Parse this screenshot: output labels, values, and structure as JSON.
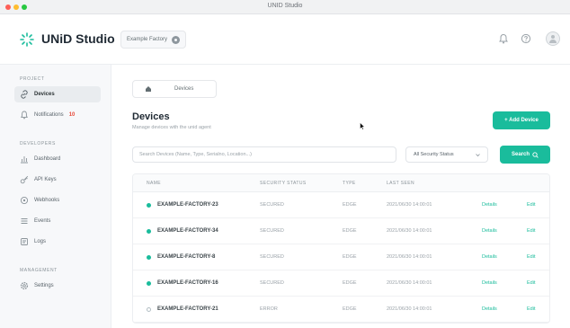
{
  "window": {
    "title": "UNID Studio"
  },
  "header": {
    "brand": "UNiD Studio",
    "project_name": "Example Factory",
    "icons": [
      "bell-icon",
      "help-icon",
      "user-avatar"
    ]
  },
  "sidebar": {
    "sections": [
      {
        "label": "PROJECT",
        "items": [
          {
            "label": "Devices",
            "icon": "link-icon",
            "active": true
          },
          {
            "label": "Notifications",
            "icon": "bell-icon",
            "badge": "10"
          }
        ]
      },
      {
        "label": "DEVELOPERS",
        "items": [
          {
            "label": "Dashboard",
            "icon": "chart-icon"
          },
          {
            "label": "API Keys",
            "icon": "key-icon"
          },
          {
            "label": "Webhooks",
            "icon": "webhook-icon"
          },
          {
            "label": "Events",
            "icon": "list-icon"
          },
          {
            "label": "Logs",
            "icon": "log-icon"
          }
        ]
      },
      {
        "label": "MANAGEMENT",
        "items": [
          {
            "label": "Settings",
            "icon": "gear-icon"
          }
        ]
      }
    ]
  },
  "breadcrumb": {
    "current": "Devices"
  },
  "page": {
    "title": "Devices",
    "subtitle": "Manage devices with the unid agent",
    "add_label": "+ Add Device"
  },
  "filters": {
    "search_placeholder": "Search Devices (Name, Type, Serialno, Location...)",
    "status_selected": "All Security Status",
    "search_label": "Search"
  },
  "table": {
    "columns": [
      "NAME",
      "SECURITY STATUS",
      "TYPE",
      "LAST SEEN"
    ],
    "rows": [
      {
        "name": "EXAMPLE-FACTORY-23",
        "status": "SECURED",
        "type": "EDGE",
        "last_seen": "2021/06/30 14:00:01",
        "online": true
      },
      {
        "name": "EXAMPLE-FACTORY-34",
        "status": "SECURED",
        "type": "EDGE",
        "last_seen": "2021/06/30 14:00:01",
        "online": true
      },
      {
        "name": "EXAMPLE-FACTORY-8",
        "status": "SECURED",
        "type": "EDGE",
        "last_seen": "2021/06/30 14:00:01",
        "online": true
      },
      {
        "name": "EXAMPLE-FACTORY-16",
        "status": "SECURED",
        "type": "EDGE",
        "last_seen": "2021/06/30 14:00:01",
        "online": true
      },
      {
        "name": "EXAMPLE-FACTORY-21",
        "status": "ERROR",
        "type": "EDGE",
        "last_seen": "2021/06/30 14:00:01",
        "online": false
      }
    ],
    "details_label": "Details",
    "edit_label": "Edit"
  },
  "colors": {
    "accent": "#1abc9c",
    "badge": "#e74c3c",
    "sidebar_bg": "#f7f8fa"
  }
}
